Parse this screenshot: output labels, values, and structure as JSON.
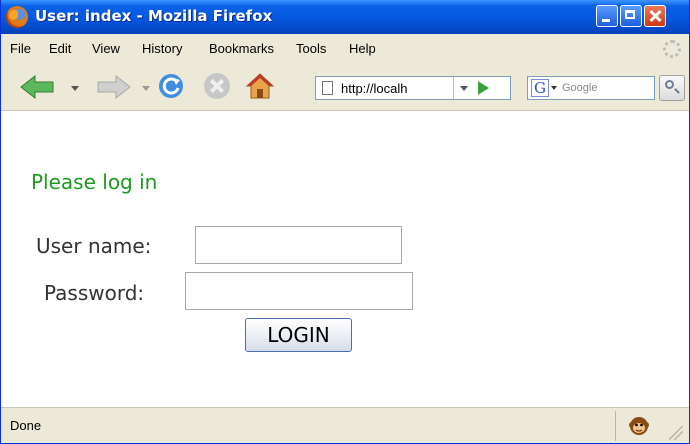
{
  "window": {
    "title": "User: index - Mozilla Firefox"
  },
  "menu": {
    "items": [
      "File",
      "Edit",
      "View",
      "History",
      "Bookmarks",
      "Tools",
      "Help"
    ]
  },
  "navbar": {
    "url": "http://localh",
    "search_placeholder": "Google",
    "search_engine_letter": "G"
  },
  "page": {
    "heading": "Please log in",
    "username_label": "User name:",
    "password_label": "Password:",
    "username_value": "",
    "password_value": "",
    "login_button": "LOGIN"
  },
  "statusbar": {
    "text": "Done"
  },
  "colors": {
    "heading": "#1e9a1e",
    "titlebar": "#0457e0"
  }
}
